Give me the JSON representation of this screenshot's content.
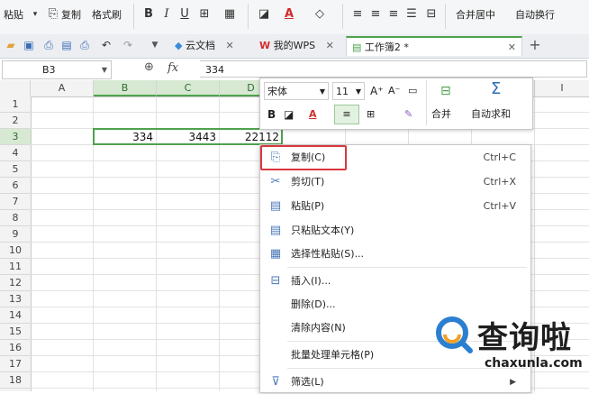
{
  "ribbon": {
    "paste_label": "粘贴",
    "copy_label": "复制",
    "format_painter_label": "格式刷",
    "bold_label": "B",
    "italic_label": "I",
    "underline_label": "U",
    "merge_center_label": "合并居中",
    "wrap_text_label": "自动换行"
  },
  "tabs": [
    {
      "label": "云文档"
    },
    {
      "label": "我的WPS"
    },
    {
      "label": "工作簿2 *"
    }
  ],
  "formula_bar": {
    "cell_ref": "B3",
    "fx_label": "fx",
    "value": "334"
  },
  "columns": [
    "A",
    "B",
    "C",
    "D",
    "I"
  ],
  "rows": [
    "1",
    "2",
    "3",
    "4",
    "5",
    "6",
    "7",
    "8",
    "9",
    "10",
    "11",
    "12",
    "13",
    "14",
    "15",
    "16",
    "17",
    "18"
  ],
  "cells": {
    "B3": "334",
    "C3": "3443",
    "D3": "22112"
  },
  "mini_toolbar": {
    "font_name": "宋体",
    "font_size": "11",
    "merge_label": "合并",
    "autosum_label": "自动求和",
    "bold_label": "B"
  },
  "context_menu": [
    {
      "label": "复制(C)",
      "shortcut": "Ctrl+C",
      "icon": "copy-icon"
    },
    {
      "label": "剪切(T)",
      "shortcut": "Ctrl+X",
      "icon": "scissors-icon"
    },
    {
      "label": "粘贴(P)",
      "shortcut": "Ctrl+V",
      "icon": "paste-icon"
    },
    {
      "label": "只粘贴文本(Y)",
      "shortcut": "",
      "icon": "paste-text-icon"
    },
    {
      "label": "选择性粘贴(S)...",
      "shortcut": "",
      "icon": "paste-special-icon"
    },
    {
      "label": "插入(I)...",
      "shortcut": "",
      "icon": "insert-icon"
    },
    {
      "label": "删除(D)...",
      "shortcut": "",
      "icon": ""
    },
    {
      "label": "清除内容(N)",
      "shortcut": "",
      "icon": ""
    },
    {
      "label": "批量处理单元格(P)",
      "shortcut": "",
      "icon": ""
    },
    {
      "label": "筛选(L)",
      "shortcut": "",
      "icon": "filter-icon"
    }
  ],
  "watermark": {
    "brand": "查询啦",
    "domain": "chaxunla.com"
  },
  "colors": {
    "accent_green": "#4ea24e",
    "highlight_red": "#d9363e",
    "select_bg": "#d7e9d2"
  }
}
